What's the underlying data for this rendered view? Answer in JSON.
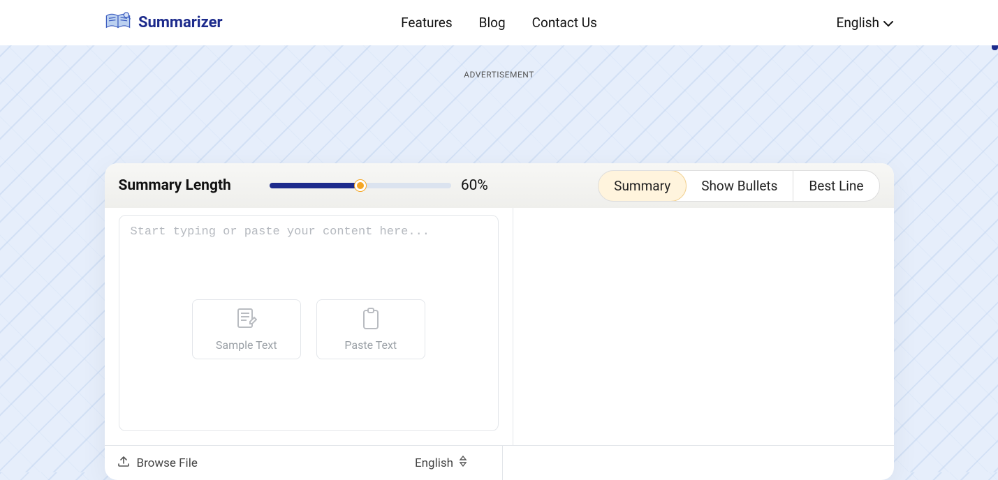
{
  "brand": {
    "name": "Summarizer"
  },
  "nav": {
    "features": "Features",
    "blog": "Blog",
    "contact": "Contact Us"
  },
  "topbar": {
    "language": "English"
  },
  "ad": {
    "label": "ADVERTISEMENT"
  },
  "controls": {
    "summary_length_label": "Summary Length",
    "summary_length_value": "60%",
    "slider_percent": 50
  },
  "tabs": {
    "summary": "Summary",
    "bullets": "Show Bullets",
    "best_line": "Best Line",
    "active": "summary"
  },
  "editor": {
    "placeholder": "Start typing or paste your content here...",
    "sample_text_label": "Sample Text",
    "paste_text_label": "Paste Text"
  },
  "footer": {
    "browse_label": "Browse File",
    "language": "English"
  }
}
